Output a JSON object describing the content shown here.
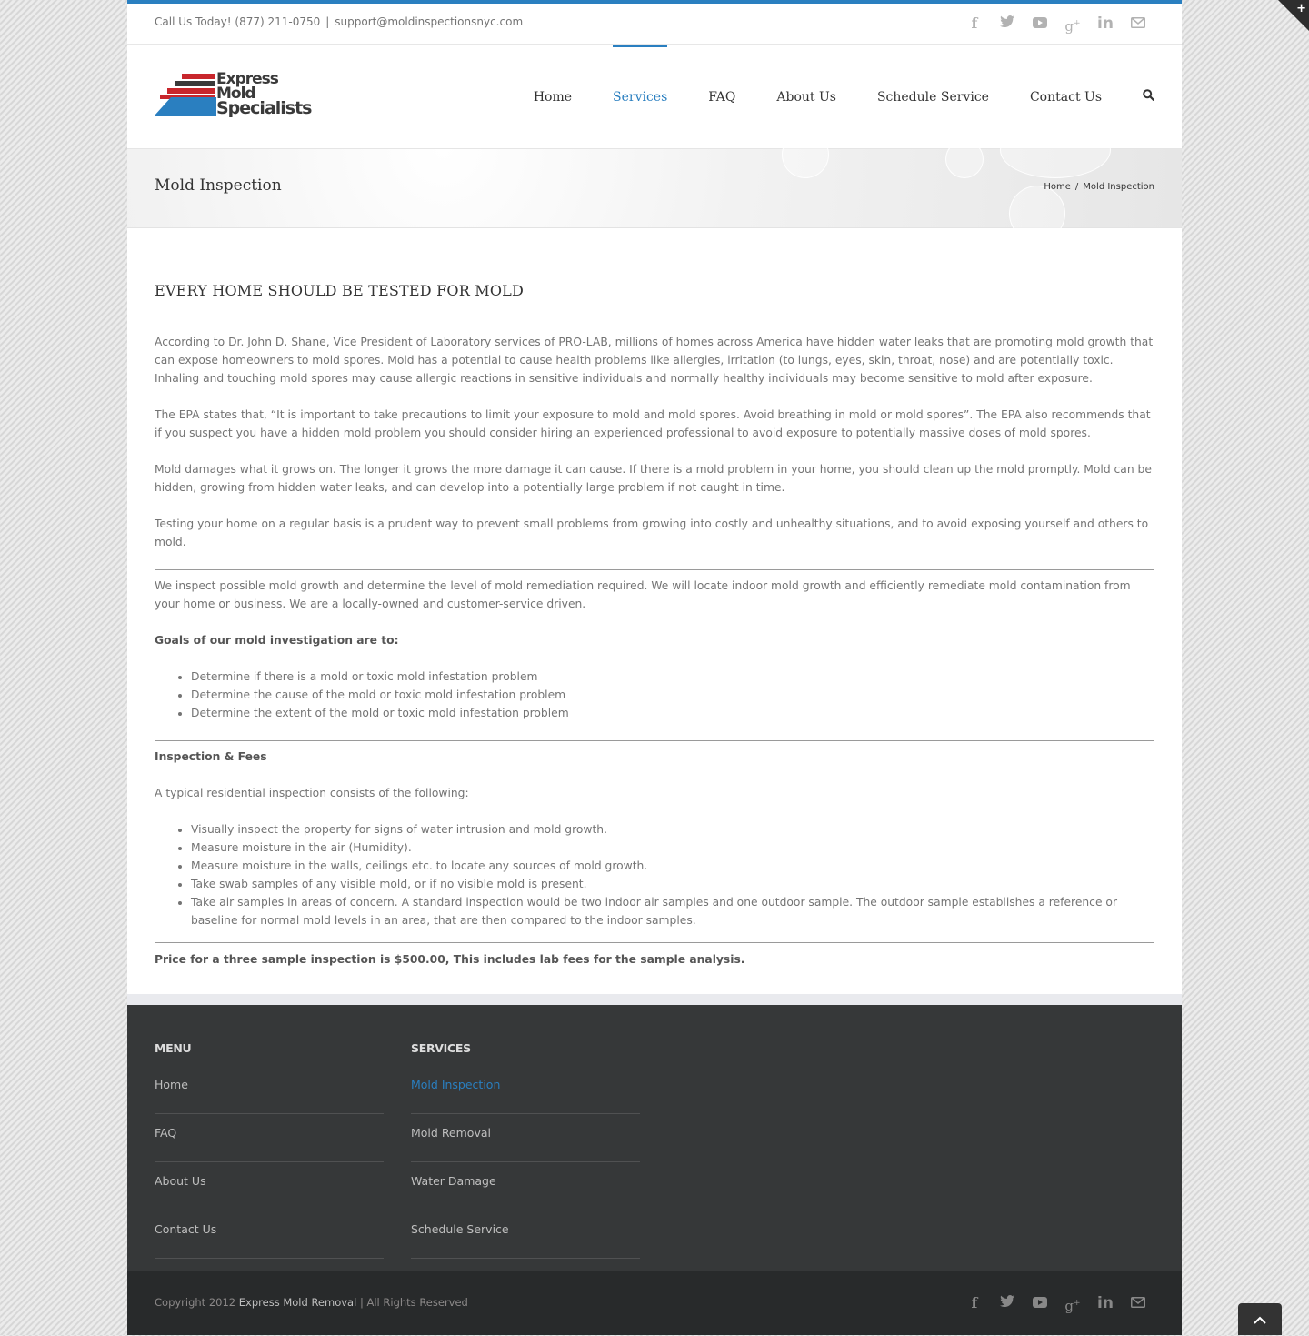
{
  "topbar": {
    "phone_text": "Call Us Today! (877) 211-0750",
    "separator": "|",
    "email": "support@moldinspectionsnyc.com",
    "social_icons": [
      "facebook-icon",
      "twitter-icon",
      "youtube-icon",
      "google-plus-icon",
      "linkedin-icon",
      "email-icon"
    ]
  },
  "logo": {
    "line1": "Express",
    "line2": "Mold",
    "line3": "Specialists"
  },
  "nav": {
    "items": [
      "Home",
      "Services",
      "FAQ",
      "About Us",
      "Schedule Service",
      "Contact Us"
    ],
    "active": "Services"
  },
  "page": {
    "title": "Mold Inspection",
    "breadcrumb": {
      "home": "Home",
      "sep": "/",
      "current": "Mold Inspection"
    }
  },
  "content": {
    "heading": "EVERY HOME SHOULD BE TESTED FOR MOLD",
    "p1": "According to Dr. John D. Shane, Vice President of Laboratory services of PRO-LAB, millions of homes across America have hidden water leaks that are promoting mold growth that can expose homeowners to mold spores.  Mold has a potential to cause health problems like allergies, irritation (to lungs, eyes, skin, throat, nose) and are potentially toxic.  Inhaling and touching mold spores may cause allergic reactions in sensitive individuals and normally healthy individuals may become sensitive to mold after exposure.",
    "p2": "The EPA states that, “It is important to take precautions to limit your exposure to mold and mold spores. Avoid breathing in mold or mold spores”. The EPA also recommends that if you suspect you have a hidden mold problem you should consider hiring an experienced professional to avoid exposure to potentially massive doses of mold spores.",
    "p3": "Mold damages what it grows on. The longer it grows the more damage it can cause. If there is a mold problem in your home, you should clean up the mold promptly.  Mold can be hidden, growing from hidden water leaks, and can develop into a potentially large problem if not caught in time.",
    "p4": "Testing your home on a regular basis is a prudent way to prevent small problems from growing into costly and unhealthy situations, and to avoid exposing yourself and others to mold.",
    "p5": "We inspect possible mold growth and determine the level of mold remediation required. We will locate indoor mold growth and efficiently remediate mold contamination from your home or business. We are a locally-owned and customer-service driven.",
    "goals_heading": "Goals of our mold investigation are to:",
    "goals": [
      "Determine if there is a mold or toxic mold infestation problem",
      "Determine the cause of the mold or toxic mold infestation problem",
      "Determine the extent of the mold or toxic mold infestation problem"
    ],
    "fees_heading": "Inspection & Fees",
    "fees_intro": "A typical residential inspection consists of the following:",
    "fees_list": [
      "Visually inspect the property for signs of water intrusion and mold growth.",
      "Measure moisture in the air (Humidity).",
      "Measure moisture in the walls, ceilings etc. to locate any sources of mold growth.",
      "Take swab samples of any visible mold, or if no visible mold is present.",
      "Take air samples in areas of concern. A standard inspection would be two indoor air samples and one outdoor sample. The outdoor sample establishes a reference or baseline for normal mold levels in an area, that are then compared to the indoor samples."
    ],
    "price": "Price for a three sample inspection is $500.00, This includes lab fees for the sample analysis."
  },
  "footer": {
    "menu_heading": "MENU",
    "menu": [
      "Home",
      "FAQ",
      "About Us",
      "Contact Us"
    ],
    "services_heading": "SERVICES",
    "services": [
      "Mold Inspection",
      "Mold Removal",
      "Water Damage",
      "Schedule Service"
    ],
    "services_active": "Mold Inspection"
  },
  "bottom": {
    "copyright_prefix": "Copyright 2012",
    "brand": "Express Mold Removal",
    "suffix": "| All Rights Reserved"
  },
  "colors": {
    "accent": "#2a7fc0",
    "footer_bg": "#363839",
    "bottom_bg": "#282a2b",
    "logo_red": "#c8262c"
  }
}
